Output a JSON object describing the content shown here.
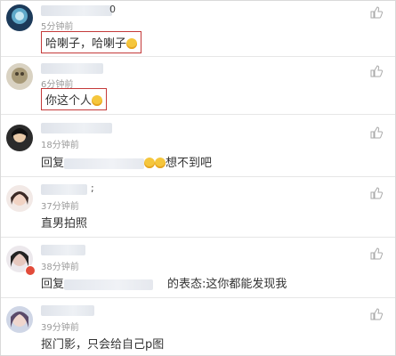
{
  "comments": [
    {
      "name_suffix": "0",
      "time": "5分钟前",
      "text": "哈喇子，哈喇子"
    },
    {
      "name_suffix": "",
      "time": "6分钟前",
      "text": "你这个人"
    },
    {
      "name_suffix": "",
      "time": "18分钟前",
      "reply_prefix": "回复",
      "text": "想不到吧"
    },
    {
      "name_suffix": ";",
      "time": "37分钟前",
      "text": "直男拍照"
    },
    {
      "name_suffix": "",
      "time": "38分钟前",
      "reply_prefix": "回复",
      "text": "的表态:这你都能发现我"
    },
    {
      "name_suffix": "",
      "time": "39分钟前",
      "text": "抠门影，只会给自己p图"
    }
  ],
  "icons": {
    "like": "thumbs-up-icon",
    "emoji": "smiley-emoji-icon"
  },
  "colors": {
    "highlight_border": "#c43a3a",
    "time_text": "#999999"
  }
}
